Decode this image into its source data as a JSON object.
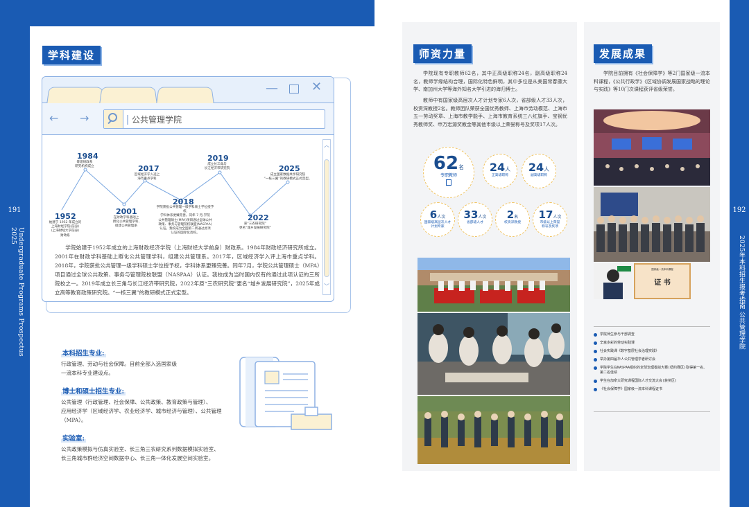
{
  "left_page": {
    "page_number": "191",
    "side_text": "Undergraduate Programs Prospectus 2025",
    "section_title": "学科建设",
    "browser": {
      "address": "公共管理学院"
    },
    "timeline": [
      {
        "year": "1984",
        "note": "筹建财政系\n研究机构成立"
      },
      {
        "year": "2017",
        "note": "区域经济学入选上\n海市重点学科"
      },
      {
        "year": "2019",
        "note": "成立长三角与\n长江经济带研究院"
      },
      {
        "year": "2025",
        "note": "成立国家数据共享研究院\n“一核三翼”的教研模式正式定型。"
      },
      {
        "year": "1952",
        "note": "始建于 1952 年成立的\n上海财经学院(前身)\n(上海财经大学前身)\n财政系"
      },
      {
        "year": "2001",
        "note": "在财政学科基础上\n孵化公共管理学科,\n组建公共管理系"
      },
      {
        "year": "2018",
        "note": "学院获批公共管理一级学科硕士学位授予权,\n学科体系更臻完善。同年 7 月,学院\n公共管理硕士(MPA)项目通过全球公共\n政策、事务与管理院校联盟(NASPAA)\n认证。我校成为全国第二所通过此项\n认证的国际化高校。"
      },
      {
        "year": "2022",
        "note": "获“三农研究院”\n更名“城乡发展研究院”"
      }
    ],
    "intro_paragraph": "学院始建于1952年成立的上海财政经济学院（上海财经大学前身）财政系。1984年财政经济研究所成立。2001年在财政学科基础上孵化公共管理学科，组建公共管理系。2017年，区域经济学入评上海市重点学科。2018年，学院获批公共管理一级学科硕士学位授予权，学科体系更臻完善。同年7月，学院公共管理硕士（MPA）项目通过全球公共政策、事务与管理院校联盟（NASPAA）认证。我校成为当时国内仅有的通过此项认证的三所院校之一。2019年成立长三角与长江经济带研究院，2022年原“三农研究院”更名“城乡发展研究院”，2025年成立高等教育政策研究院。“一核三翼”的教研模式正式定型。",
    "programs": [
      {
        "heading": "本科招生专业:",
        "text": "行政管理、劳动与社会保障。目前全部入选国家级\n一流本科专业建设点。"
      },
      {
        "heading": "博士和硕士招生专业:",
        "text": "公共管理（行政管理、社会保障、公共政策、教育政策与管理）、\n应用经济学（区域经济学、农业经济学、城市经济与管理）、公共管理（MPA）。"
      },
      {
        "heading": "实验室:",
        "text": "公共政策模拟与仿真实验室、长三角三农研究系列数据模拟实验室、\n长三角城市群经济空间数据中心、长三角一体化发展空间实验室。"
      }
    ]
  },
  "right_page": {
    "page_number": "192",
    "side_text": "2025年本科招生报考指南 公共管理学院",
    "faculty": {
      "title": "师资力量",
      "paragraph1": "学院现有专职教师62名，其中正高级职称24名，副高级职称24名，教师学缘结构合理，国际化特色鲜明，其中多位是从美国常春藤大学、南加州大学等海外知名大学引进的海归博士。",
      "paragraph2": "教师中有国家级高层次人才计划专家6人次，省部级人才33人次，校资深教授2名。教师团队荣获全国优秀教师、上海市劳动模范、上海市五一劳动奖章、上海市教学能手、上海市教育系统三八红旗手、宝钢优秀教师奖、申万宏源奖教金等其他市级以上荣誉称号及奖项17人次。",
      "stats": [
        {
          "num": "62",
          "unit": "名",
          "label": "专职教师"
        },
        {
          "num": "24",
          "unit": "人",
          "label": "正高级职称"
        },
        {
          "num": "24",
          "unit": "人",
          "label": "副高级职称"
        },
        {
          "num": "6",
          "unit": "人次",
          "label": "国家级高层次人才\n计划专家"
        },
        {
          "num": "33",
          "unit": "人次",
          "label": "省部级人才"
        },
        {
          "num": "2",
          "unit": "名",
          "label": "校资深教授"
        },
        {
          "num": "17",
          "unit": "人次",
          "label": "市级以上荣誉\n称号及奖项"
        }
      ]
    },
    "achievements": {
      "title": "发展成果",
      "paragraph": "学院目前拥有《社会保障学》等2门国家级一流本科课程，《公共行政学》《区域协调发展国家战略的理论与实践》等10门次课程获评省级荣誉。",
      "certificate_title": "证 书",
      "certificate_small": "国家级一流本科课程",
      "list": [
        "学院师生参与干部调查",
        "辛富多彩的劳动实践课",
        "社会实践课《数字基层社会治理实践》",
        "举办第四届华人公共管理学者研讨会",
        "学院学生在NASPAA组织的全球治理模拟大赛(纽约赛区)取得第一名、第二名佳绩",
        "学生在加拿大研究课程国际人才交流大会(获奖区)",
        "《社会保障学》国家级一流本科课程证书"
      ]
    }
  },
  "colors": {
    "brand_blue": "#1a5bb3",
    "accent_yellow": "#f1c462",
    "panel_gray": "#f3f4f6"
  }
}
